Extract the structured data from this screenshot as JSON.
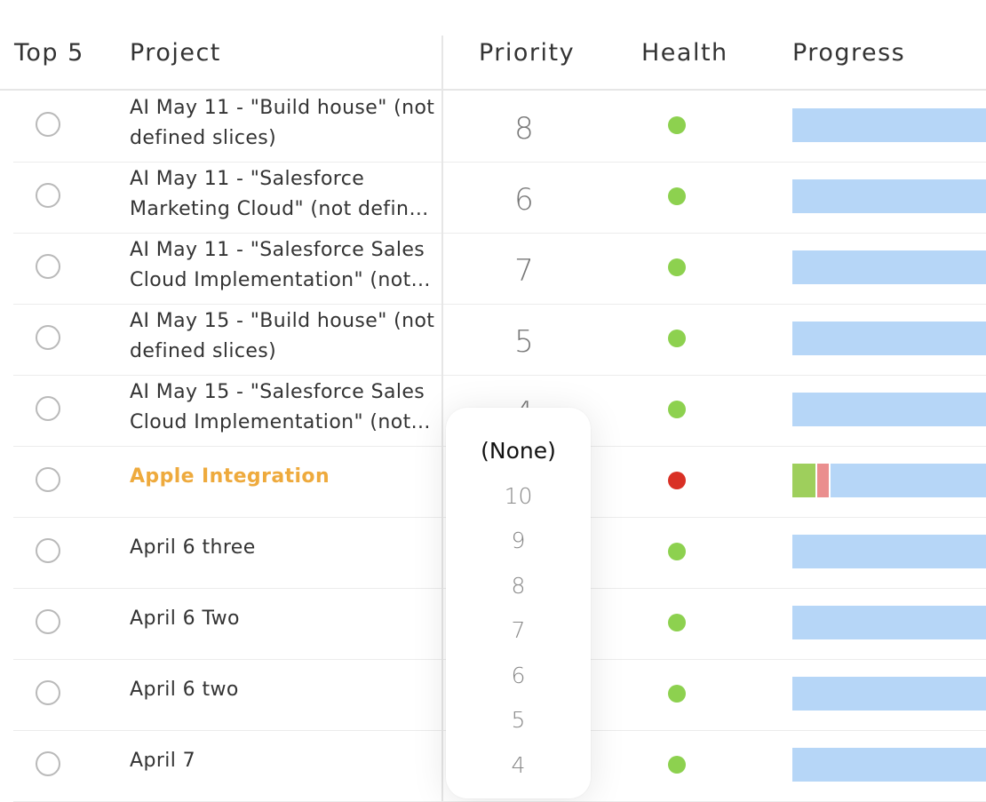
{
  "header": {
    "top5": "Top 5",
    "project": "Project",
    "priority": "Priority",
    "health": "Health",
    "progress": "Progress"
  },
  "colors": {
    "health_green": "#8dd14f",
    "health_red": "#d93025",
    "progress_bar": "#b6d6f7",
    "progress_done": "#9ecf5c",
    "progress_late": "#ea8e8e",
    "highlight_project": "#eeaa3d"
  },
  "rows": [
    {
      "lines": [
        "AI May 11 - \"Build house\" (not",
        "defined slices)"
      ],
      "priority": "8",
      "health": "green"
    },
    {
      "lines": [
        "AI May 11 - \"Salesforce",
        "Marketing Cloud\" (not define..."
      ],
      "priority": "6",
      "health": "green"
    },
    {
      "lines": [
        "AI May 11 - \"Salesforce Sales",
        "Cloud Implementation\" (not..."
      ],
      "priority": "7",
      "health": "green"
    },
    {
      "lines": [
        "AI May 15 - \"Build house\" (not",
        "defined slices)"
      ],
      "priority": "5",
      "health": "green"
    },
    {
      "lines": [
        "AI May 15 - \"Salesforce Sales",
        "Cloud Implementation\" (not..."
      ],
      "priority": "4",
      "health": "green"
    },
    {
      "lines": [
        "Apple Integration"
      ],
      "priority": "",
      "health": "red",
      "highlight": true,
      "progress_done": 0.12,
      "progress_late": 0.06
    },
    {
      "lines": [
        "April 6 three"
      ],
      "priority": "",
      "health": "green"
    },
    {
      "lines": [
        "April 6 Two"
      ],
      "priority": "",
      "health": "green"
    },
    {
      "lines": [
        "April 6 two"
      ],
      "priority": "",
      "health": "green"
    },
    {
      "lines": [
        "April 7"
      ],
      "priority": "",
      "health": "green"
    }
  ],
  "priority_dropdown": {
    "options": [
      "(None)",
      "10",
      "9",
      "8",
      "7",
      "6",
      "5",
      "4"
    ],
    "selected": "(None)"
  }
}
